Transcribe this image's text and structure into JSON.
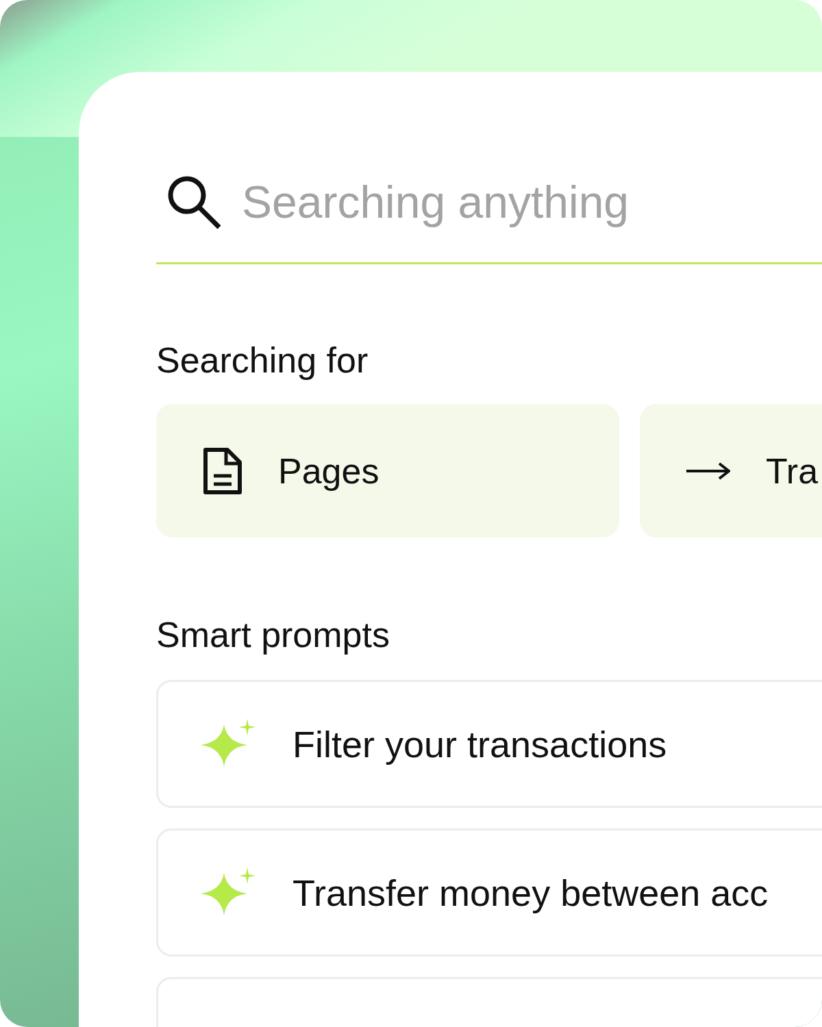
{
  "search": {
    "placeholder": "Searching anything"
  },
  "searching_for": {
    "title": "Searching for",
    "chips": [
      {
        "kind": "page",
        "label": "Pages"
      },
      {
        "kind": "arrow",
        "label": "Tra"
      }
    ]
  },
  "smart_prompts": {
    "title": "Smart prompts",
    "items": [
      {
        "kind": "prompt",
        "label": "Filter your transactions"
      },
      {
        "kind": "prompt",
        "label": "Transfer money between acc"
      },
      {
        "kind": "blank"
      }
    ]
  }
}
